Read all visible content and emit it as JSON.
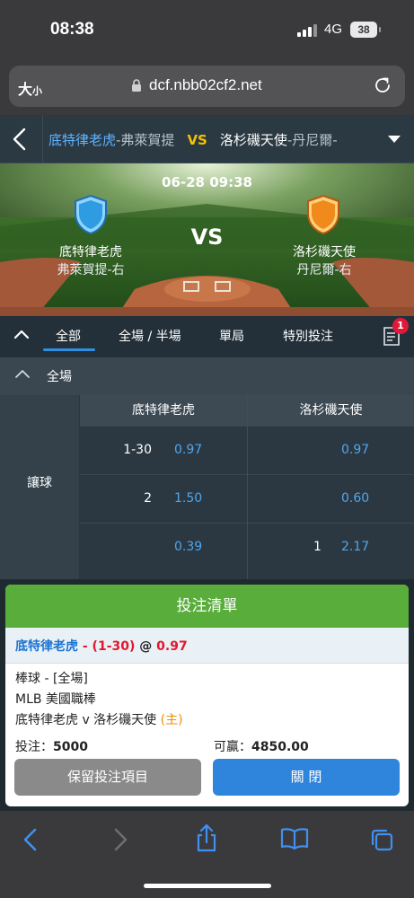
{
  "status_bar": {
    "time": "08:38",
    "network": "4G",
    "battery": "38"
  },
  "browser": {
    "text_size_label": "大",
    "text_size_small": "小",
    "url": "dcf.nbb02cf2.net"
  },
  "match_header": {
    "home_team": "底特律老虎",
    "home_pitcher": "-弗萊賀提",
    "vs": "VS",
    "away_team": "洛杉磯天使",
    "away_pitcher": "-丹尼爾-"
  },
  "banner": {
    "datetime": "06-28 09:38",
    "vs": "VS",
    "home_team": "底特律老虎",
    "home_pitcher": "弗萊賀提-右",
    "away_team": "洛杉磯天使",
    "away_pitcher": "丹尼爾-右",
    "home_color": "#2f9be0",
    "away_color": "#f08a1c"
  },
  "tabs": {
    "items": [
      "全部",
      "全場 / 半場",
      "單局",
      "特別投注"
    ],
    "active": "全部",
    "badge_count": "1"
  },
  "section": {
    "label": "全場"
  },
  "odds_table": {
    "market": "讓球",
    "home_header": "底特律老虎",
    "away_header": "洛杉磯天使",
    "rows": [
      {
        "home_hcp": "1-30",
        "home_odds": "0.97",
        "away_hcp": "",
        "away_odds": "0.97"
      },
      {
        "home_hcp": "2",
        "home_odds": "1.50",
        "away_hcp": "",
        "away_odds": "0.60"
      },
      {
        "home_hcp": "",
        "home_odds": "0.39",
        "away_hcp": "1",
        "away_odds": "2.17"
      }
    ]
  },
  "bet_slip": {
    "title": "投注清單",
    "selection_team": "底特律老虎",
    "selection_hcp": " - (1-30)",
    "selection_at": " @ ",
    "selection_odds": "0.97",
    "sport_line": "棒球 - [全場]",
    "league": "MLB 美國職棒",
    "matchup": "底特律老虎 v 洛杉磯天使 ",
    "home_tag": "(主)",
    "stake_label": "投注：",
    "stake_value": "5000",
    "win_label": "可贏：",
    "win_value": "4850.00",
    "keep_button": "保留投注項目",
    "close_button": "關 閉",
    "accent": "#58ad3b"
  },
  "icons": [
    "signal-icon",
    "lock-icon",
    "reload-icon",
    "back-chevron-icon",
    "dropdown-icon",
    "collapse-caret-icon",
    "bet-list-icon",
    "safari-back-icon",
    "safari-forward-icon",
    "share-icon",
    "bookmarks-icon",
    "tabs-icon"
  ]
}
